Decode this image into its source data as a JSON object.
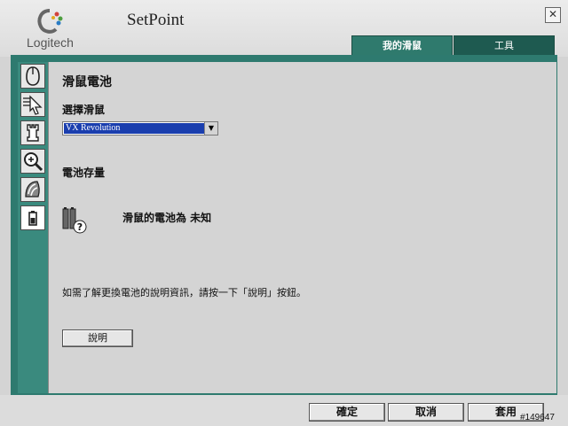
{
  "window": {
    "brand": "Logitech",
    "title": "SetPoint",
    "close_glyph": "✕"
  },
  "tabs": [
    {
      "label": "我的滑鼠",
      "active": true
    },
    {
      "label": "工具",
      "active": false
    }
  ],
  "sidebar": {
    "items": [
      {
        "icon": "mouse-icon",
        "active": false
      },
      {
        "icon": "pointer-speed-icon",
        "active": false
      },
      {
        "icon": "chess-rook-icon",
        "active": false
      },
      {
        "icon": "zoom-icon",
        "active": false
      },
      {
        "icon": "scroll-wheel-icon",
        "active": false
      },
      {
        "icon": "battery-icon",
        "active": true
      }
    ]
  },
  "main": {
    "heading": "滑鼠電池",
    "select_label": "選擇滑鼠",
    "selected_mouse": "VX Revolution",
    "battery_heading": "電池存量",
    "battery_status": "滑鼠的電池為 未知",
    "help_info": "如需了解更換電池的說明資訊，請按一下「說明」按鈕。",
    "help_button": "說明"
  },
  "footer": {
    "ok": "確定",
    "cancel": "取消",
    "apply": "套用"
  },
  "watermark": "#149647",
  "colors": {
    "accent_teal": "#2e7a6f",
    "selection_blue": "#1a3eae"
  }
}
